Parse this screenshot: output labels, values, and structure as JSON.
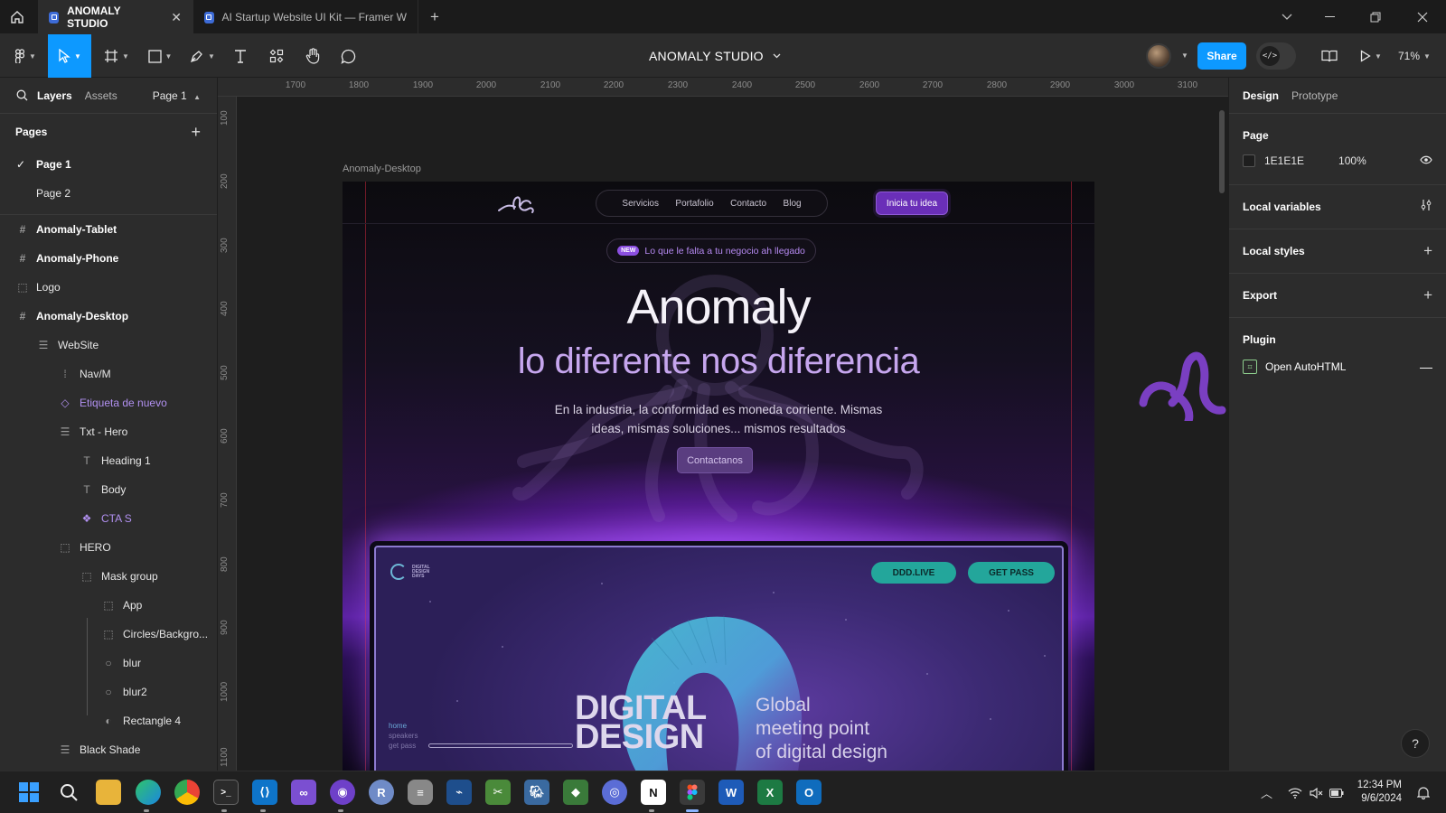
{
  "window": {
    "tabs": [
      {
        "title": "ANOMALY STUDIO",
        "active": true
      },
      {
        "title": "AI Startup Website UI Kit — Framer W",
        "active": false
      }
    ]
  },
  "toolbar": {
    "file_title": "ANOMALY STUDIO",
    "share_label": "Share",
    "zoom": "71%",
    "dev_mode_glyph": "</>"
  },
  "left_panel": {
    "tab_layers": "Layers",
    "tab_assets": "Assets",
    "page_picker": "Page 1",
    "pages_title": "Pages",
    "pages": [
      {
        "name": "Page 1",
        "current": true
      },
      {
        "name": "Page 2",
        "current": false
      }
    ],
    "layers": [
      {
        "name": "Anomaly-Tablet",
        "icon": "frame-icon"
      },
      {
        "name": "Anomaly-Phone",
        "icon": "frame-icon"
      },
      {
        "name": "Logo",
        "icon": "group-icon"
      },
      {
        "name": "Anomaly-Desktop",
        "icon": "frame-icon"
      },
      {
        "name": "WebSite",
        "icon": "auto-layout-vertical-icon"
      },
      {
        "name": "Nav/M",
        "icon": "auto-layout-horizontal-icon"
      },
      {
        "name": "Etiqueta de nuevo",
        "icon": "component-instance-icon"
      },
      {
        "name": "Txt - Hero",
        "icon": "auto-layout-vertical-icon"
      },
      {
        "name": "Heading 1",
        "icon": "text-icon"
      },
      {
        "name": "Body",
        "icon": "text-icon"
      },
      {
        "name": "CTA S",
        "icon": "component-instance-icon"
      },
      {
        "name": "HERO",
        "icon": "group-icon"
      },
      {
        "name": "Mask group",
        "icon": "group-icon"
      },
      {
        "name": "App",
        "icon": "group-icon"
      },
      {
        "name": "Circles/Backgro...",
        "icon": "group-icon"
      },
      {
        "name": "blur",
        "icon": "ellipse-icon"
      },
      {
        "name": "blur2",
        "icon": "ellipse-icon"
      },
      {
        "name": "Rectangle 4",
        "icon": "mask-icon"
      },
      {
        "name": "Black Shade",
        "icon": "auto-layout-vertical-icon"
      }
    ]
  },
  "canvas": {
    "ruler_x": [
      "1700",
      "1800",
      "1900",
      "2000",
      "2100",
      "2200",
      "2300",
      "2400",
      "2500",
      "2600",
      "2700",
      "2800",
      "2900",
      "3000",
      "3100"
    ],
    "ruler_y": [
      "100",
      "200",
      "300",
      "400",
      "500",
      "600",
      "700",
      "800",
      "900",
      "1000",
      "1100"
    ],
    "frame_label": "Anomaly-Desktop",
    "site": {
      "nav": [
        "Servicios",
        "Portafolio",
        "Contacto",
        "Blog"
      ],
      "nav_cta": "Inicia tu idea",
      "badge_new": "NEW",
      "badge_text": "Lo que le falta a tu negocio ah llegado",
      "heading": "Anomaly",
      "subheading": "lo diferente nos diferencia",
      "body_line1": "En la industria, la conformidad es moneda corriente. Mismas",
      "body_line2": "ideas, mismas soluciones... mismos resultados",
      "cta": "Contactanos",
      "app": {
        "logo_text": [
          "DIGITAL",
          "DESIGN",
          "DAYS"
        ],
        "btn_live": "DDD.LIVE",
        "btn_pass": "GET PASS",
        "title_line1": "DIGITAL",
        "title_line2": "DESIGN",
        "sub_line1": "Global",
        "sub_line2": "meeting point",
        "sub_line3": "of digital design",
        "side_nav": [
          "home",
          "speakers",
          "get pass"
        ]
      }
    }
  },
  "right_panel": {
    "tab_design": "Design",
    "tab_prototype": "Prototype",
    "page_section": "Page",
    "page_color": "1E1E1E",
    "page_opacity": "100%",
    "local_variables": "Local variables",
    "local_styles": "Local styles",
    "export": "Export",
    "plugin": "Plugin",
    "plugin_item": "Open AutoHTML",
    "help": "?"
  },
  "taskbar": {
    "time": "12:34 PM",
    "date": "9/6/2024"
  },
  "colors": {
    "accent": "#0d99ff",
    "canvas_bg": "#1e1e1e",
    "panel_bg": "#2c2c2c",
    "component": "#b190f0",
    "site_purple": "#6a2fb8",
    "app_teal": "#23a69b"
  }
}
